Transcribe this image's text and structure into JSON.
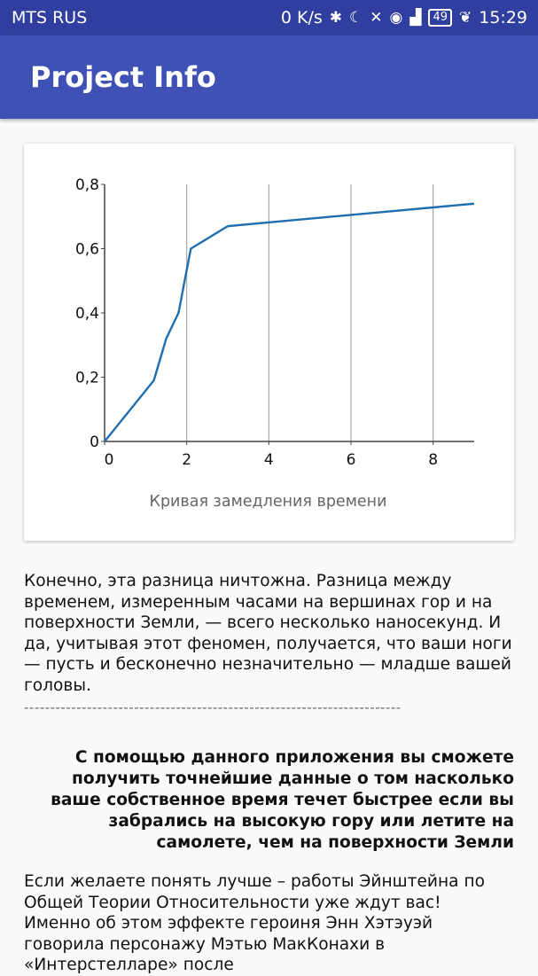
{
  "status_bar": {
    "carrier": "MTS RUS",
    "speed": "0 K/s",
    "battery": "49",
    "time": "15:29",
    "icons": [
      "bluetooth-icon",
      "moon-icon",
      "mute-icon",
      "eye-icon",
      "signal-4g-icon",
      "battery-icon",
      "leaf-icon"
    ]
  },
  "app_bar": {
    "title": "Project Info"
  },
  "chart_data": {
    "type": "line",
    "x": [
      0,
      1.2,
      1.5,
      1.8,
      2.1,
      3.0,
      9.0
    ],
    "series": [
      {
        "values": [
          0,
          0.19,
          0.32,
          0.4,
          0.6,
          0.67,
          0.74
        ],
        "color": "#1f6fb0"
      }
    ],
    "xlabel": "Кривая замедления времени",
    "ylabel": "",
    "xlim": [
      0,
      9
    ],
    "ylim": [
      0,
      0.8
    ],
    "x_ticks": [
      "0",
      "2",
      "4",
      "6",
      "8"
    ],
    "y_ticks": [
      "0",
      "0,2",
      "0,4",
      "0,6",
      "0,8"
    ],
    "grid": "vertical"
  },
  "content": {
    "paragraph1": "Конечно, эта разница ничтожна. Разница между временем, измеренным часами на вершинах гор и на поверхности Земли, — всего несколько наносекунд. И да, учитывая этот феномен, получается, что ваши ноги — пусть и бесконечно незначительно — младше вашей головы.",
    "divider": "------------------------------------------------------------------------",
    "emphasis": "С помощью данного приложения вы сможете получить точнейшие данные о том насколько ваше собственное время течет быстрее если вы забрались на высокую гору или летите на самолете, чем на поверхности Земли",
    "paragraph2_line1": "Если желаете понять лучше – работы Эйнштейна по Общей Теории Относительности уже ждут вас!",
    "paragraph2_line2": " Именно об этом эффекте героиня Энн Хэтэуэй говорила персонажу Мэтью МакКонахи в «Интерстелларе» после"
  }
}
